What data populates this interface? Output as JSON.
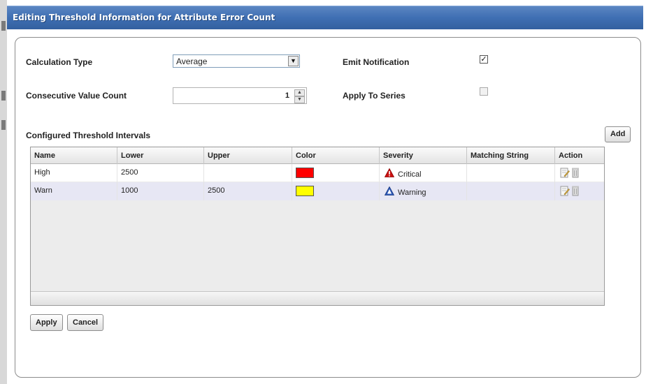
{
  "dialog": {
    "title": "Editing Threshold Information for Attribute Error Count"
  },
  "form": {
    "calculation_type_label": "Calculation Type",
    "calculation_type_value": "Average",
    "consecutive_value_count_label": "Consecutive Value Count",
    "consecutive_value_count_value": "1",
    "emit_notification_label": "Emit Notification",
    "emit_notification_checked": true,
    "emit_notification_mark": "✓",
    "apply_to_series_label": "Apply To Series",
    "apply_to_series_checked": false
  },
  "intervals": {
    "section_label": "Configured Threshold Intervals",
    "add_label": "Add",
    "columns": [
      "Name",
      "Lower",
      "Upper",
      "Color",
      "Severity",
      "Matching String",
      "Action"
    ],
    "rows": [
      {
        "name": "High",
        "lower": "2500",
        "upper": "",
        "color": "#ff0000",
        "severity": "Critical",
        "severity_icon": "critical-triangle-icon",
        "severity_color": "#cc1111",
        "matching": ""
      },
      {
        "name": "Warn",
        "lower": "1000",
        "upper": "2500",
        "color": "#ffff00",
        "severity": "Warning",
        "severity_icon": "warning-triangle-icon",
        "severity_color": "#2e59b8",
        "matching": ""
      }
    ]
  },
  "footer": {
    "apply_label": "Apply",
    "cancel_label": "Cancel"
  }
}
